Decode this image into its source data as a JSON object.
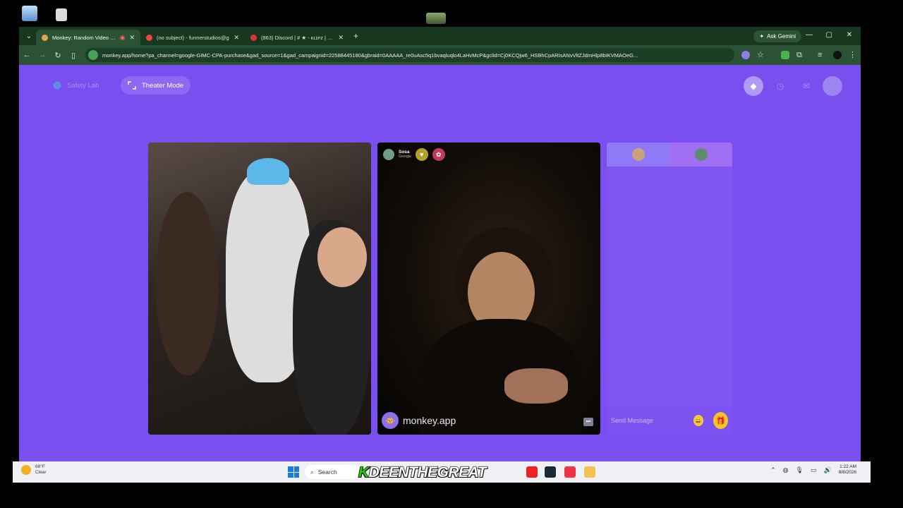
{
  "browser": {
    "tabs": [
      {
        "title": "Monkey: Random Video Ch",
        "active": true,
        "favicon_color": "#e4a64a"
      },
      {
        "title": "(no subject) - funnerstudios@g",
        "active": false,
        "favicon_color": "#e44"
      },
      {
        "title": "(863) Discord | # ★ - ᴋʟɪᴘᴢ | $ɢʀ",
        "active": false,
        "favicon_color": "#d33"
      }
    ],
    "ask_gemini": "Ask Gemini",
    "url": "monkey.app/home?pa_channel=google-GIMC-CPA-purchase&gad_source=1&gad_campaignid=22588445180&gbraid=0AAAAA_re0uAsc5q1bvaqluqlo4LaHvMcP&gclid=Cj0KCQjw6_HSBhCpARIsANvVltZJdmHlp8bIKVMAOeG..."
  },
  "page": {
    "safety_label": "Safety Lab",
    "theater_label": "Theater Mode"
  },
  "remote_user": {
    "name": "Sosa",
    "location": "Georgia"
  },
  "watermark": "monkey.app",
  "chat": {
    "placeholder": "Send Message"
  },
  "taskbar": {
    "weather_temp": "68°F",
    "weather_desc": "Clear",
    "search_label": "Search",
    "overlay_prefix": "K",
    "overlay_rest": "DEENTHEGREAT",
    "time": "1:22 AM",
    "date": "8/8/2026"
  },
  "colors": {
    "page_bg": "#7a4ff0",
    "browser_chrome": "#2b5234",
    "gift_yellow": "#f5c521",
    "overlay_green": "#1fd100"
  }
}
